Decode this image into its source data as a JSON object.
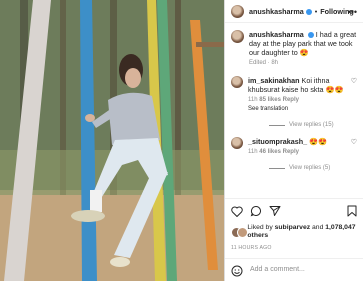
{
  "post": {
    "username": "anushkasharma",
    "follow_label": "Following",
    "more_icon": "more-horizontal-icon",
    "caption": {
      "username": "anushkasharma",
      "text": "I had a great day at the play park that we took our daughter to",
      "emoji": "😍",
      "meta": "Edited · 8h"
    },
    "comments": [
      {
        "username": "im_sakinakhan",
        "text": "Koi ithna khubsurat kaise ho skta",
        "emoji": "😍😍",
        "time": "11h",
        "likes": "85 likes",
        "reply": "Reply",
        "translation": "See translation",
        "view_replies": "View replies (15)"
      },
      {
        "username": "_situomprakash_",
        "text": "",
        "emoji": "😍😍",
        "time": "11h",
        "likes": "46 likes",
        "reply": "Reply",
        "view_replies": "View replies (5)"
      }
    ],
    "likes": {
      "prefix": "Liked by",
      "liker": "subiparvez",
      "connector": "and",
      "count": "1,078,047 others"
    },
    "timestamp": "11 HOURS AGO",
    "add_comment_placeholder": "Add a comment..."
  },
  "icons": {
    "like": "heart-icon",
    "comment": "comment-icon",
    "share": "share-icon",
    "save": "bookmark-icon",
    "emoji": "smiley-icon"
  },
  "colors": {
    "verified": "#3897f0",
    "muted": "#8e8e8e",
    "text": "#262626"
  }
}
